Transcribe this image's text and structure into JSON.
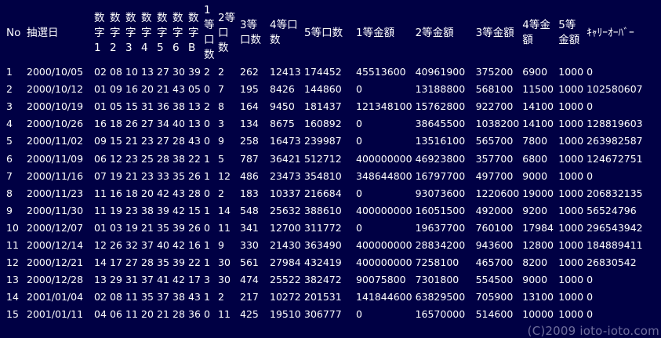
{
  "headers": {
    "no": "No",
    "date": "抽選日",
    "d1": "数字1",
    "d2": "数字2",
    "d3": "数字3",
    "d4": "数字4",
    "d5": "数字5",
    "d6": "数字6",
    "bonus": "数字B",
    "win1_count": "1等口数",
    "win2_count": "2等口数",
    "win3_count": "3等口数",
    "win4_count": "4等口数",
    "win5_count": "5等口数",
    "prize1": "1等金額",
    "prize2": "2等金額",
    "prize3": "3等金額",
    "prize4": "4等金額",
    "prize5": "5等金額",
    "carryover": "ｷｬﾘｰｵｰﾊﾞｰ"
  },
  "rows": [
    {
      "no": "1",
      "date": "2000/10/05",
      "d1": "02",
      "d2": "08",
      "d3": "10",
      "d4": "13",
      "d5": "27",
      "d6": "30",
      "b": "39",
      "w1": "2",
      "w2": "2",
      "w3": "262",
      "w4": "12413",
      "w5": "174452",
      "p1": "45513600",
      "p2": "40961900",
      "p3": "375200",
      "p4": "6900",
      "p5": "1000",
      "co": "0"
    },
    {
      "no": "2",
      "date": "2000/10/12",
      "d1": "01",
      "d2": "09",
      "d3": "16",
      "d4": "20",
      "d5": "21",
      "d6": "43",
      "b": "05",
      "w1": "0",
      "w2": "7",
      "w3": "195",
      "w4": "8426",
      "w5": "144860",
      "p1": "0",
      "p2": "13188800",
      "p3": "568100",
      "p4": "11500",
      "p5": "1000",
      "co": "102580607"
    },
    {
      "no": "3",
      "date": "2000/10/19",
      "d1": "01",
      "d2": "05",
      "d3": "15",
      "d4": "31",
      "d5": "36",
      "d6": "38",
      "b": "13",
      "w1": "2",
      "w2": "8",
      "w3": "164",
      "w4": "9450",
      "w5": "181437",
      "p1": "121348100",
      "p2": "15762800",
      "p3": "922700",
      "p4": "14100",
      "p5": "1000",
      "co": "0"
    },
    {
      "no": "4",
      "date": "2000/10/26",
      "d1": "16",
      "d2": "18",
      "d3": "26",
      "d4": "27",
      "d5": "34",
      "d6": "40",
      "b": "13",
      "w1": "0",
      "w2": "3",
      "w3": "134",
      "w4": "8675",
      "w5": "160892",
      "p1": "0",
      "p2": "38645500",
      "p3": "1038200",
      "p4": "14100",
      "p5": "1000",
      "co": "128819603"
    },
    {
      "no": "5",
      "date": "2000/11/02",
      "d1": "09",
      "d2": "15",
      "d3": "21",
      "d4": "23",
      "d5": "27",
      "d6": "28",
      "b": "43",
      "w1": "0",
      "w2": "9",
      "w3": "258",
      "w4": "16473",
      "w5": "239987",
      "p1": "0",
      "p2": "13516100",
      "p3": "565700",
      "p4": "7800",
      "p5": "1000",
      "co": "263982587"
    },
    {
      "no": "6",
      "date": "2000/11/09",
      "d1": "06",
      "d2": "12",
      "d3": "23",
      "d4": "25",
      "d5": "28",
      "d6": "38",
      "b": "22",
      "w1": "1",
      "w2": "5",
      "w3": "787",
      "w4": "36421",
      "w5": "512712",
      "p1": "400000000",
      "p2": "46923800",
      "p3": "357700",
      "p4": "6800",
      "p5": "1000",
      "co": "124672751"
    },
    {
      "no": "7",
      "date": "2000/11/16",
      "d1": "07",
      "d2": "19",
      "d3": "21",
      "d4": "23",
      "d5": "33",
      "d6": "35",
      "b": "26",
      "w1": "1",
      "w2": "12",
      "w3": "486",
      "w4": "23473",
      "w5": "354810",
      "p1": "348644800",
      "p2": "16797700",
      "p3": "497700",
      "p4": "9000",
      "p5": "1000",
      "co": "0"
    },
    {
      "no": "8",
      "date": "2000/11/23",
      "d1": "11",
      "d2": "16",
      "d3": "18",
      "d4": "20",
      "d5": "42",
      "d6": "43",
      "b": "28",
      "w1": "0",
      "w2": "2",
      "w3": "183",
      "w4": "10337",
      "w5": "216684",
      "p1": "0",
      "p2": "93073600",
      "p3": "1220600",
      "p4": "19000",
      "p5": "1000",
      "co": "206832135"
    },
    {
      "no": "9",
      "date": "2000/11/30",
      "d1": "11",
      "d2": "19",
      "d3": "23",
      "d4": "38",
      "d5": "39",
      "d6": "42",
      "b": "15",
      "w1": "1",
      "w2": "14",
      "w3": "548",
      "w4": "25632",
      "w5": "388610",
      "p1": "400000000",
      "p2": "16051500",
      "p3": "492000",
      "p4": "9200",
      "p5": "1000",
      "co": "56524796"
    },
    {
      "no": "10",
      "date": "2000/12/07",
      "d1": "01",
      "d2": "03",
      "d3": "19",
      "d4": "21",
      "d5": "35",
      "d6": "39",
      "b": "26",
      "w1": "0",
      "w2": "11",
      "w3": "341",
      "w4": "12700",
      "w5": "311772",
      "p1": "0",
      "p2": "19637700",
      "p3": "760100",
      "p4": "17984",
      "p5": "1000",
      "co": "296543942"
    },
    {
      "no": "11",
      "date": "2000/12/14",
      "d1": "12",
      "d2": "26",
      "d3": "32",
      "d4": "37",
      "d5": "40",
      "d6": "42",
      "b": "16",
      "w1": "1",
      "w2": "9",
      "w3": "330",
      "w4": "21430",
      "w5": "363490",
      "p1": "400000000",
      "p2": "28834200",
      "p3": "943600",
      "p4": "12800",
      "p5": "1000",
      "co": "184889411"
    },
    {
      "no": "12",
      "date": "2000/12/21",
      "d1": "14",
      "d2": "17",
      "d3": "27",
      "d4": "28",
      "d5": "35",
      "d6": "39",
      "b": "22",
      "w1": "1",
      "w2": "30",
      "w3": "561",
      "w4": "27984",
      "w5": "432419",
      "p1": "400000000",
      "p2": "7258100",
      "p3": "465700",
      "p4": "8200",
      "p5": "1000",
      "co": "26830542"
    },
    {
      "no": "13",
      "date": "2000/12/28",
      "d1": "13",
      "d2": "29",
      "d3": "31",
      "d4": "37",
      "d5": "41",
      "d6": "42",
      "b": "17",
      "w1": "3",
      "w2": "30",
      "w3": "474",
      "w4": "25522",
      "w5": "382472",
      "p1": "90075800",
      "p2": "7301800",
      "p3": "554500",
      "p4": "9000",
      "p5": "1000",
      "co": "0"
    },
    {
      "no": "14",
      "date": "2001/01/04",
      "d1": "02",
      "d2": "08",
      "d3": "11",
      "d4": "35",
      "d5": "37",
      "d6": "38",
      "b": "43",
      "w1": "1",
      "w2": "2",
      "w3": "217",
      "w4": "10272",
      "w5": "201531",
      "p1": "141844600",
      "p2": "63829500",
      "p3": "705900",
      "p4": "13100",
      "p5": "1000",
      "co": "0"
    },
    {
      "no": "15",
      "date": "2001/01/11",
      "d1": "04",
      "d2": "06",
      "d3": "11",
      "d4": "20",
      "d5": "21",
      "d6": "28",
      "b": "36",
      "w1": "0",
      "w2": "11",
      "w3": "425",
      "w4": "19510",
      "w5": "306777",
      "p1": "0",
      "p2": "16570000",
      "p3": "514600",
      "p4": "10000",
      "p5": "1000",
      "co": "0"
    }
  ],
  "watermark": "(C)2009 ioto-ioto.com"
}
